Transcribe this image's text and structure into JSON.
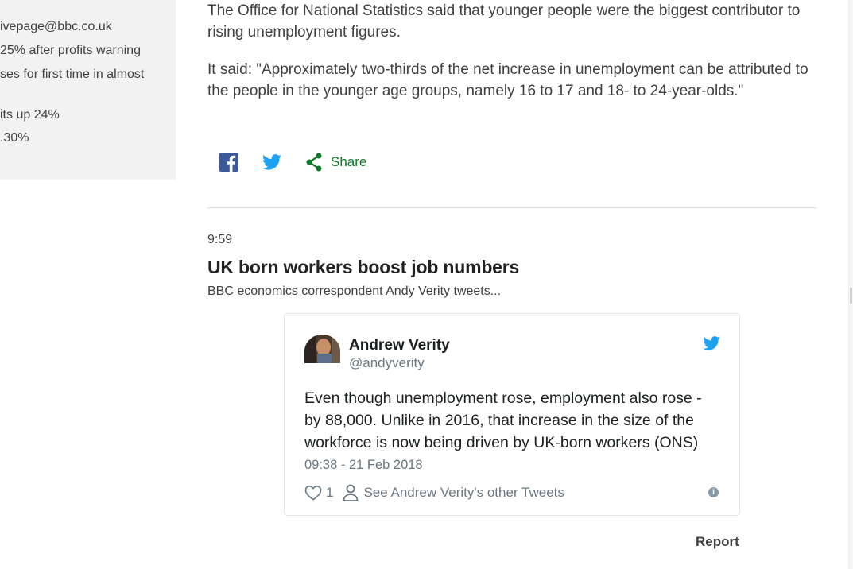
{
  "sidebar": {
    "lines": [
      "ivepage@bbc.co.uk",
      " 25% after profits warning",
      "ses for first time in almost",
      "its up 24%",
      ".30%"
    ]
  },
  "article": {
    "paragraph_1": "The Office for National Statistics said that younger people were the biggest contributor to rising unemployment figures.",
    "paragraph_2": "It said: \"Approximately two-thirds of the net increase in unemployment can be attributed to the people in the younger age groups, namely 16 to 17 and 18- to 24-year-olds.\""
  },
  "share": {
    "label": "Share",
    "icons": [
      "facebook-icon",
      "twitter-icon",
      "share-icon"
    ]
  },
  "post": {
    "time": "9:59",
    "headline": "UK born workers boost job numbers",
    "subline": "BBC economics correspondent Andy Verity tweets..."
  },
  "tweet": {
    "author_name": "Andrew Verity",
    "author_handle": "@andyverity",
    "text": "Even though unemployment rose, employment also rose - by 88,000. Unlike in 2016, that increase in the size of the workforce is now being driven by UK-born workers (ONS)",
    "date": "09:38 - 21 Feb 2018",
    "like_count": "1",
    "others_label": "See Andrew Verity's other Tweets",
    "info_glyph": "i"
  },
  "report": {
    "label": "Report"
  },
  "colors": {
    "share_green": "#0a7a26",
    "facebook_blue": "#3b5998",
    "twitter_blue": "#1da1f2",
    "muted_gray": "#697882"
  }
}
